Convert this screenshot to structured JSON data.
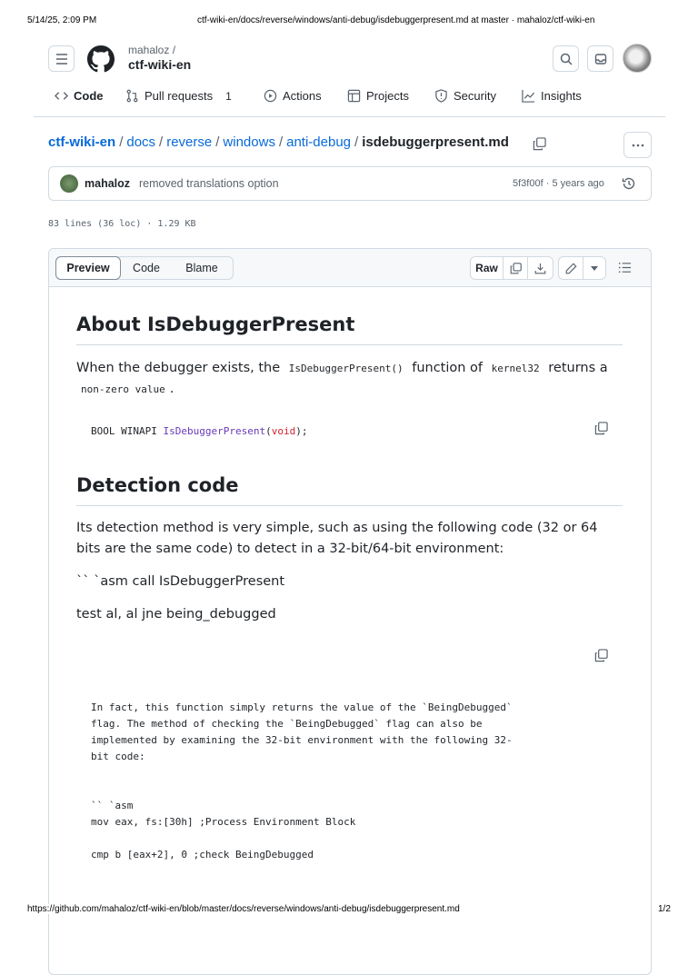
{
  "print_header": {
    "datetime": "5/14/25, 2:09 PM",
    "title": "ctf-wiki-en/docs/reverse/windows/anti-debug/isdebuggerpresent.md at master · mahaloz/ctf-wiki-en"
  },
  "print_footer": {
    "url": "https://github.com/mahaloz/ctf-wiki-en/blob/master/docs/reverse/windows/anti-debug/isdebuggerpresent.md",
    "page": "1/2"
  },
  "header": {
    "owner": "mahaloz /",
    "repo": "ctf-wiki-en"
  },
  "nav": [
    {
      "label": "Code",
      "icon": "code-icon"
    },
    {
      "label": "Pull requests",
      "icon": "pull-request-icon",
      "count": "1"
    },
    {
      "label": "Actions",
      "icon": "play-icon"
    },
    {
      "label": "Projects",
      "icon": "table-icon"
    },
    {
      "label": "Security",
      "icon": "shield-icon"
    },
    {
      "label": "Insights",
      "icon": "graph-icon"
    }
  ],
  "breadcrumb": {
    "parts": [
      "ctf-wiki-en",
      "docs",
      "reverse",
      "windows",
      "anti-debug"
    ],
    "separator": "/",
    "file": "isdebuggerpresent.md"
  },
  "commit": {
    "author": "mahaloz",
    "message": "removed translations option",
    "sha": "5f3f00f",
    "age": "5 years ago",
    "dot": "·"
  },
  "file_info": "83 lines (36 loc) · 1.29 KB",
  "toolbar": {
    "tabs": [
      "Preview",
      "Code",
      "Blame"
    ],
    "active": "Preview",
    "raw": "Raw"
  },
  "content": {
    "h1": "About IsDebuggerPresent",
    "p1_a": "When the debugger exists, the",
    "p1_code1": "IsDebuggerPresent()",
    "p1_b": "function of",
    "p1_code2": "kernel32",
    "p1_c": "returns a",
    "p1_code3": "non-zero value",
    "p1_d": ".",
    "code1": {
      "a": "BOOL WINAPI ",
      "fn": "IsDebuggerPresent",
      "paren1": "(",
      "kw": "void",
      "paren2": ");"
    },
    "h2": "Detection code",
    "p2": "Its detection method is very simple, such as using the following code (32 or 64 bits are the same code) to detect in a 32-bit/64-bit environment:",
    "p3": "`` `asm call IsDebuggerPresent",
    "p4": "test al, al jne being_debugged",
    "pre": "In fact, this function simply returns the value of the `BeingDebugged`\nflag. The method of checking the `BeingDebugged` flag can also be\nimplemented by examining the 32-bit environment with the following 32-\nbit code:\n\n\n`` `asm\nmov eax, fs:[30h] ;Process Environment Block\n\ncmp b [eax+2], 0 ;check BeingDebugged"
  },
  "colors": {
    "link": "#0969da",
    "fn": "#6639ba",
    "keyword": "#cf222e"
  }
}
